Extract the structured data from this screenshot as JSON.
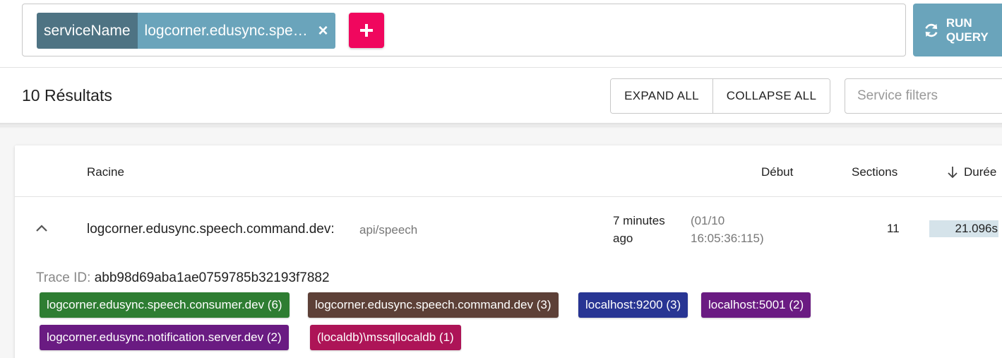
{
  "query": {
    "chip_key": "serviceName",
    "chip_value": "logcorner.edusync.speech.command.dev",
    "chip_close": "×",
    "add_label": "+",
    "run_label": "RUN QUERY"
  },
  "results": {
    "count_label": "10 Résultats",
    "expand_all": "EXPAND ALL",
    "collapse_all": "COLLAPSE ALL",
    "service_filter_placeholder": "Service filters"
  },
  "table": {
    "headers": {
      "racine": "Racine",
      "debut": "Début",
      "sections": "Sections",
      "duree": "Durée"
    },
    "row": {
      "root_service": "logcorner.edusync.speech.command.dev:",
      "root_path": "api/speech",
      "start_relative": "7 minutes ago",
      "start_absolute": "(01/10 16:05:36:115)",
      "sections": "11",
      "duration": "21.096s",
      "trace_label": "Trace ID:",
      "trace_id": "abb98d69aba1ae0759785b32193f7882",
      "tags": [
        {
          "label": "logcorner.edusync.speech.consumer.dev (6)",
          "color": "#2e7d32"
        },
        {
          "label": "logcorner.edusync.speech.command.dev (3)",
          "color": "#5d4037"
        },
        {
          "label": "localhost:9200 (3)",
          "color": "#283593"
        },
        {
          "label": "localhost:5001 (2)",
          "color": "#6a1b82"
        },
        {
          "label": "logcorner.edusync.notification.server.dev (2)",
          "color": "#6a1b82"
        },
        {
          "label": "(localdb)\\mssqllocaldb (1)",
          "color": "#ad1457"
        }
      ]
    }
  },
  "colors": {
    "chip_key_bg": "#4e7383",
    "chip_value_bg": "#6aa4bb",
    "add_button_bg": "#f0075e",
    "run_button_bg": "#6aa4bb",
    "duration_bar_bg": "#d5e3ea"
  },
  "icons": {
    "chip_close": "close-icon",
    "add": "plus-icon",
    "run": "refresh-icon",
    "row_toggle": "chevron-up-icon",
    "sort": "arrow-down-icon"
  }
}
